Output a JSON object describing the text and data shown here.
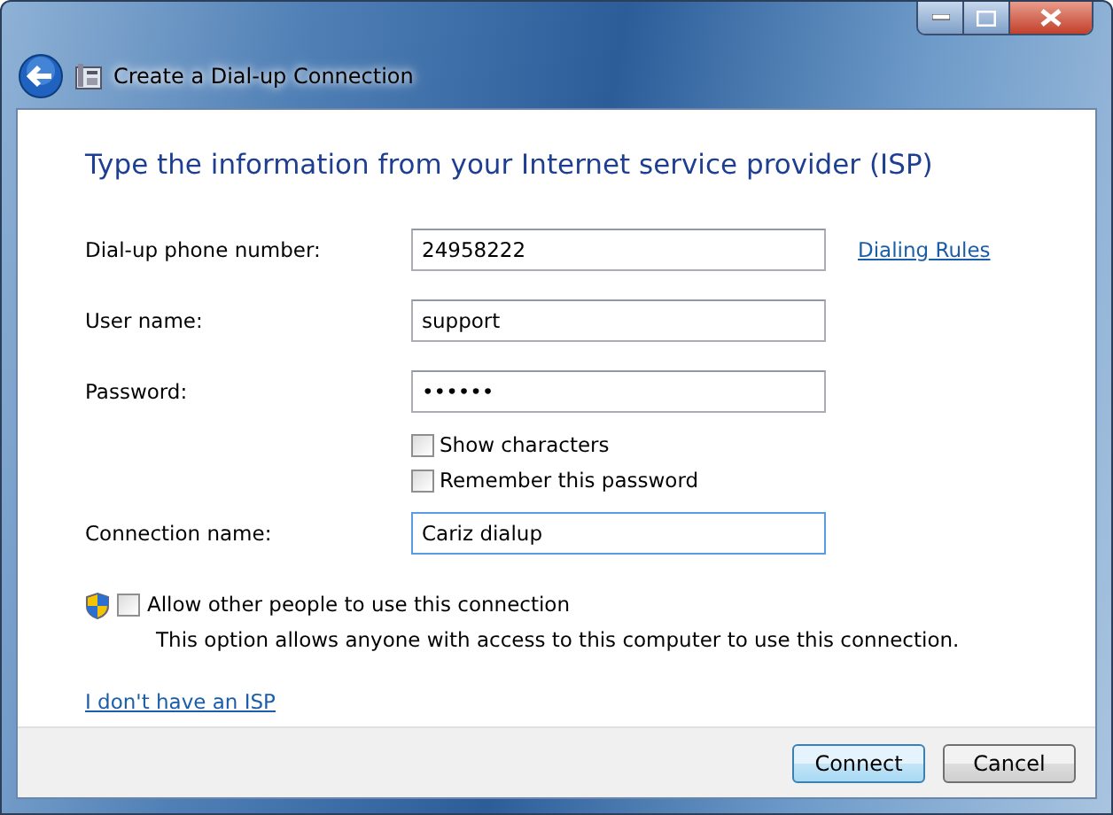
{
  "window": {
    "title": "Create a Dial-up Connection"
  },
  "heading": "Type the information from your Internet service provider (ISP)",
  "fields": [
    {
      "label": "Dial-up phone number:",
      "value": "24958222",
      "focused": false,
      "link": "Dialing Rules"
    },
    {
      "label": "User name:",
      "value": "support",
      "focused": false
    },
    {
      "label": "Password:",
      "value": "••••••",
      "focused": false
    },
    {
      "kind": "checkbox",
      "label": "Show characters",
      "checked": false
    },
    {
      "kind": "checkbox",
      "label": "Remember this password",
      "checked": false
    },
    {
      "label": "Connection name:",
      "value": "Cariz dialup",
      "focused": true
    }
  ],
  "allow_others": {
    "label": "Allow other people to use this connection",
    "checked": false,
    "note": "This option allows anyone with access to this computer to use this connection."
  },
  "isp_link": "I don't have an ISP",
  "buttons": [
    {
      "label": "Connect",
      "default": true
    },
    {
      "label": "Cancel",
      "default": false
    }
  ]
}
